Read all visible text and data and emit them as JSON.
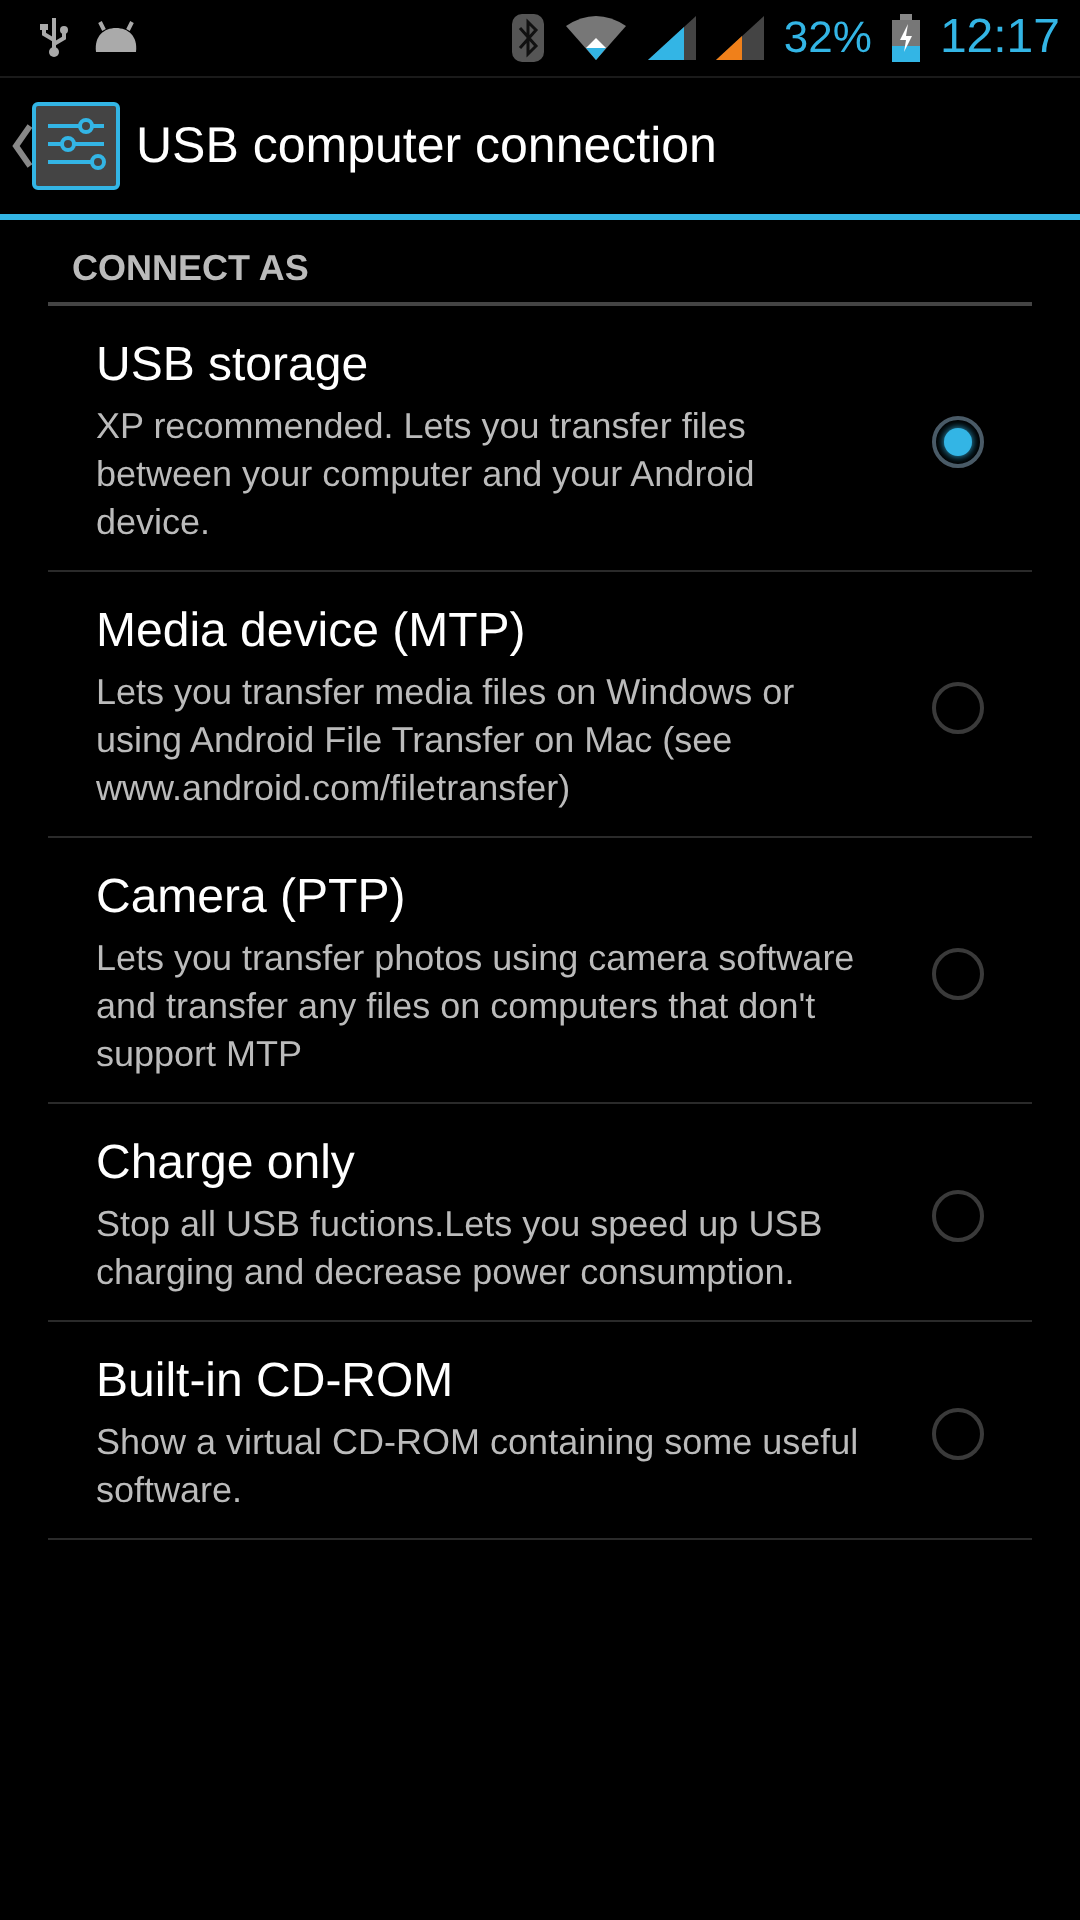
{
  "status_bar": {
    "battery": "32%",
    "time": "12:17"
  },
  "action_bar": {
    "title": "USB computer connection"
  },
  "section": {
    "title": "CONNECT AS"
  },
  "options": [
    {
      "title": "USB storage",
      "summary": "XP recommended. Lets you transfer files between your computer and your Android device.",
      "selected": true
    },
    {
      "title": "Media device (MTP)",
      "summary": "Lets you transfer media files on Windows or using Android File Transfer on Mac (see www.android.com/filetransfer)",
      "selected": false
    },
    {
      "title": "Camera (PTP)",
      "summary": "Lets you transfer photos using camera software and transfer any files on computers that don't support MTP",
      "selected": false
    },
    {
      "title": "Charge only",
      "summary": "Stop all USB fuctions.Lets you speed up USB charging and decrease power consumption.",
      "selected": false
    },
    {
      "title": "Built-in CD-ROM",
      "summary": "Show a virtual CD-ROM containing some useful software.",
      "selected": false
    }
  ]
}
